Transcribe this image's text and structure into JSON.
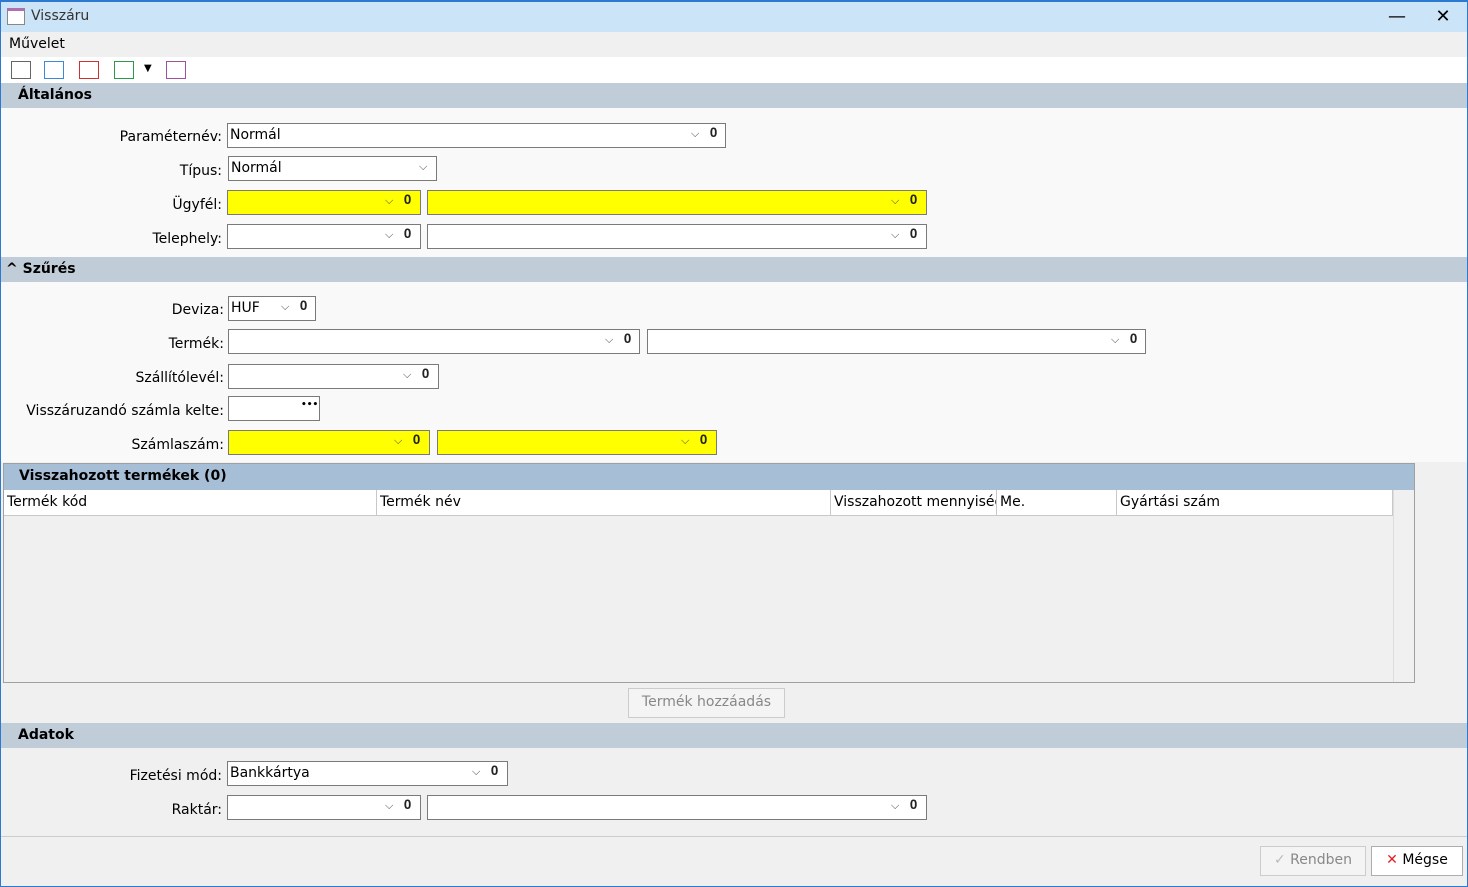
{
  "window": {
    "title": "Visszáru",
    "minimize": "—",
    "close": "✕"
  },
  "menu": {
    "items": [
      "Művelet"
    ]
  },
  "toolbar": {
    "icons": [
      "edit-attachment-icon",
      "import-icon",
      "delete-icon",
      "approve-icon",
      "dropdown-arrow-icon",
      "save-list-icon"
    ],
    "dropdown": "▼"
  },
  "sections": {
    "general": "Általános",
    "filter": "Szűrés",
    "data": "Adatok"
  },
  "general": {
    "param_label": "Paraméternév:",
    "param_value": "Normál",
    "type_label": "Típus:",
    "type_value": "Normál",
    "customer_label": "Ügyfél:",
    "customer_code": "",
    "customer_name": "",
    "site_label": "Telephely:",
    "site_code": "",
    "site_name": ""
  },
  "filter": {
    "collapse": "^",
    "currency_label": "Deviza:",
    "currency_value": "HUF",
    "product_label": "Termék:",
    "delivery_label": "Szállítólevél:",
    "invoice_date_label": "Visszáruzandó számla kelte:",
    "ellipsis": "•••",
    "invoice_no_label": "Számlaszám:"
  },
  "grid": {
    "title": "Visszahozott termékek (0)",
    "columns": [
      "Termék kód",
      "Termék név",
      "Visszahozott mennyiség",
      "Me.",
      "Gyártási szám"
    ],
    "rows": []
  },
  "add_product": "Termék hozzáadás",
  "data": {
    "payment_label": "Fizetési mód:",
    "payment_value": "Bankkártya",
    "warehouse_label": "Raktár:"
  },
  "footer": {
    "ok": "Rendben",
    "cancel": "Mégse"
  },
  "glyphs": {
    "chevron": "⌵",
    "clip": "🖇"
  }
}
